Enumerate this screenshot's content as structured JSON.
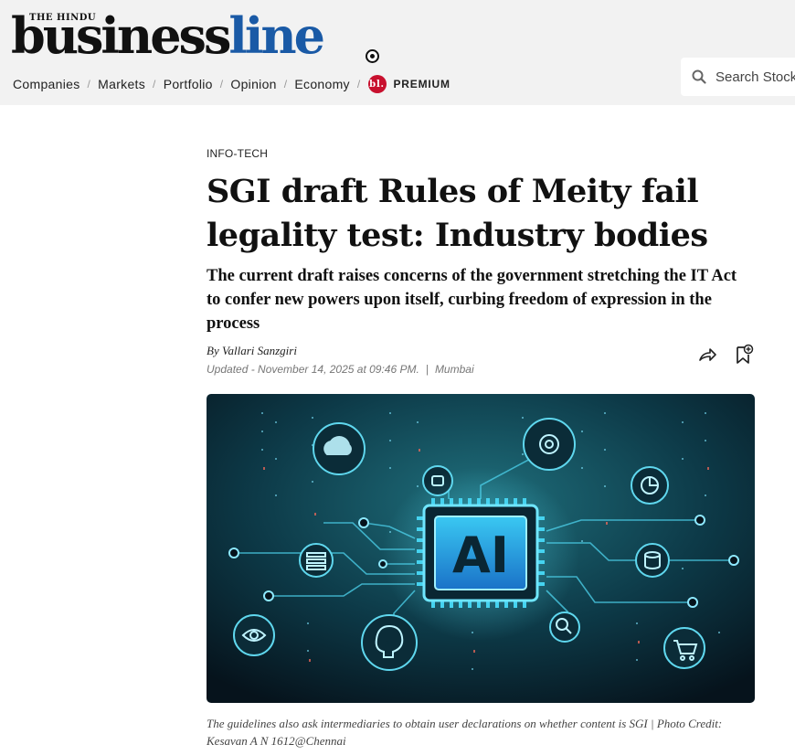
{
  "header": {
    "brand_top": "THE HINDU",
    "brand_part1": "business",
    "brand_part2": "line",
    "nav": [
      {
        "label": "Companies"
      },
      {
        "label": "Markets"
      },
      {
        "label": "Portfolio"
      },
      {
        "label": "Opinion"
      },
      {
        "label": "Economy"
      }
    ],
    "premium_badge": "bl.",
    "premium_label": "PREMIUM",
    "search_placeholder": "Search Stock Quotes",
    "search_icon": "search-icon"
  },
  "article": {
    "category": "INFO-TECH",
    "headline": "SGI draft Rules of Meity fail legality test: Industry bodies",
    "subheadline": "The current draft raises concerns of the government stretching the IT Act to confer new powers upon itself, curbing freedom of expression in the process",
    "byline_prefix": "By",
    "author": "Vallari Sanzgiri",
    "updated": "Updated - November 14, 2025 at 09:46 PM.",
    "location": "Mumbai",
    "share_icon": "share-icon",
    "bookmark_icon": "bookmark-add-icon",
    "image_label": "AI",
    "caption": "The guidelines also ask intermediaries to obtain user declarations on whether content is SGI | Photo Credit: Kesavan A N 1612@Chennai"
  },
  "colors": {
    "brand_blue": "#1a5aa6",
    "premium_red": "#c8102e",
    "header_bg": "#f2f2f2",
    "hero_accent": "#38d6f0"
  }
}
